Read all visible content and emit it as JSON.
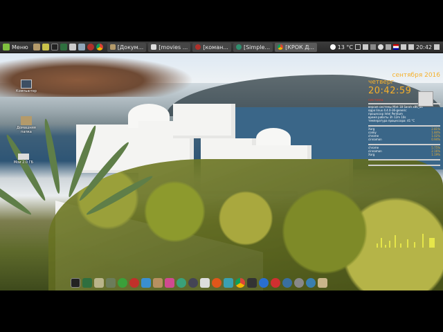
{
  "panel": {
    "menu_label": "Меню",
    "tasks": [
      {
        "label": "[Докум...",
        "icon": "folder-icon"
      },
      {
        "label": "[movies ...",
        "icon": "text-editor-icon"
      },
      {
        "label": "[коман...",
        "icon": "cherry-icon"
      },
      {
        "label": "[Simple...",
        "icon": "app-icon"
      },
      {
        "label": "[КРОК Д...",
        "icon": "chrome-icon"
      }
    ],
    "weather": "13 °C",
    "clock": "20:42"
  },
  "desktop_icons": [
    {
      "label": "Компьютер",
      "icon": "computer-icon"
    },
    {
      "label": "Домашняя папка",
      "icon": "home-folder-icon"
    },
    {
      "label": "Мои 2.0 ГБ",
      "icon": "drive-icon"
    }
  ],
  "conky": {
    "date": "сентября 2016",
    "weekday": "четверг",
    "time": "20:42:59",
    "system_title": "система",
    "system_lines": [
      "версия системы Mint 18 Sarah x86_64",
      "ядро linux 4.4.0-36-generic",
      "процессор Intel Pentium",
      "время работы 3h 12m 10s",
      "температура процессора: 41 °C"
    ],
    "cpu_rows": [
      {
        "name": "Xorg",
        "value": "2.81%"
      },
      {
        "name": "conky",
        "value": "1.84%"
      },
      {
        "name": "chrome",
        "value": "1.02%"
      },
      {
        "name": "cinnamon",
        "value": "0.94%"
      }
    ],
    "mem_rows": [
      {
        "name": "chrome",
        "value": "5.75%"
      },
      {
        "name": "cinnamon",
        "value": "2.16%"
      },
      {
        "name": "Xorg",
        "value": "1.19%"
      }
    ]
  },
  "colors": {
    "conky_accent": "#f6b02a",
    "conky_heading": "#d23c2a",
    "panel_bg": "#2e2e2e"
  }
}
